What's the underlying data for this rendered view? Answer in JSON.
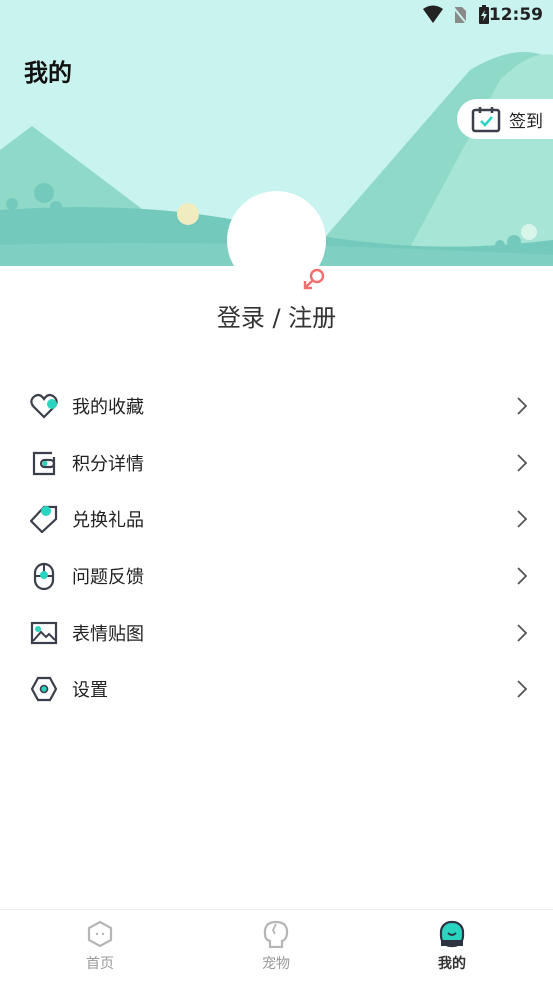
{
  "status": {
    "time": "12:59",
    "icons": [
      "wifi-icon",
      "no-sim-icon",
      "battery-charging-icon"
    ]
  },
  "header": {
    "title": "我的",
    "checkin_label": "签到"
  },
  "profile": {
    "login_text": "登录 / 注册"
  },
  "menu": [
    {
      "label": "我的收藏",
      "icon": "heart-icon"
    },
    {
      "label": "积分详情",
      "icon": "wallet-icon"
    },
    {
      "label": "兑换礼品",
      "icon": "tag-icon"
    },
    {
      "label": "问题反馈",
      "icon": "mouse-icon"
    },
    {
      "label": "表情贴图",
      "icon": "image-icon"
    },
    {
      "label": "设置",
      "icon": "hexagon-settings-icon"
    }
  ],
  "tabs": [
    {
      "label": "首页",
      "active": false
    },
    {
      "label": "宠物",
      "active": false
    },
    {
      "label": "我的",
      "active": true
    }
  ],
  "colors": {
    "accent": "#2bd4c0",
    "header_bg": "#c9f3ee",
    "female": "#f07070",
    "icon_stroke": "#3a3f4b"
  }
}
